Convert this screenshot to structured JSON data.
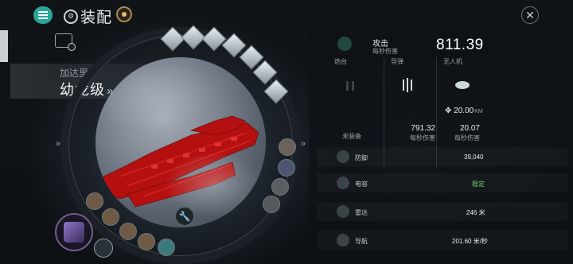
{
  "header": {
    "title": "装配"
  },
  "ship": {
    "faction": "加达里",
    "name": "幼龙级",
    "chevron": "»"
  },
  "nav": {
    "left_chevron": "»",
    "right_chevron": "»"
  },
  "attack": {
    "label": "攻击",
    "sublabel": "每秒伤害",
    "value": "811.39"
  },
  "weapon_columns": [
    {
      "title": "炮台",
      "status": "未装备",
      "value": "",
      "sub": ""
    },
    {
      "title": "导弹",
      "status": "",
      "value": "791.32",
      "sub": "每秒伤害"
    },
    {
      "title": "无人机",
      "status": "",
      "value": "20.07",
      "sub": "每秒伤害",
      "range_value": "20.00",
      "range_unit": "KM"
    }
  ],
  "stats": [
    {
      "label": "防御",
      "value": "39,040",
      "icon": "shield-icon"
    },
    {
      "label": "电容",
      "value": "稳定",
      "icon": "capacitor-icon",
      "color": "#6fd06f"
    },
    {
      "label": "雷达",
      "value": "246 米",
      "icon": "radar-icon"
    },
    {
      "label": "导航",
      "value": "201.60 米/秒",
      "icon": "navigation-icon"
    }
  ],
  "colors": {
    "accent": "#2aa59a",
    "stable": "#6fd06f",
    "ship_red": "#c01515"
  }
}
